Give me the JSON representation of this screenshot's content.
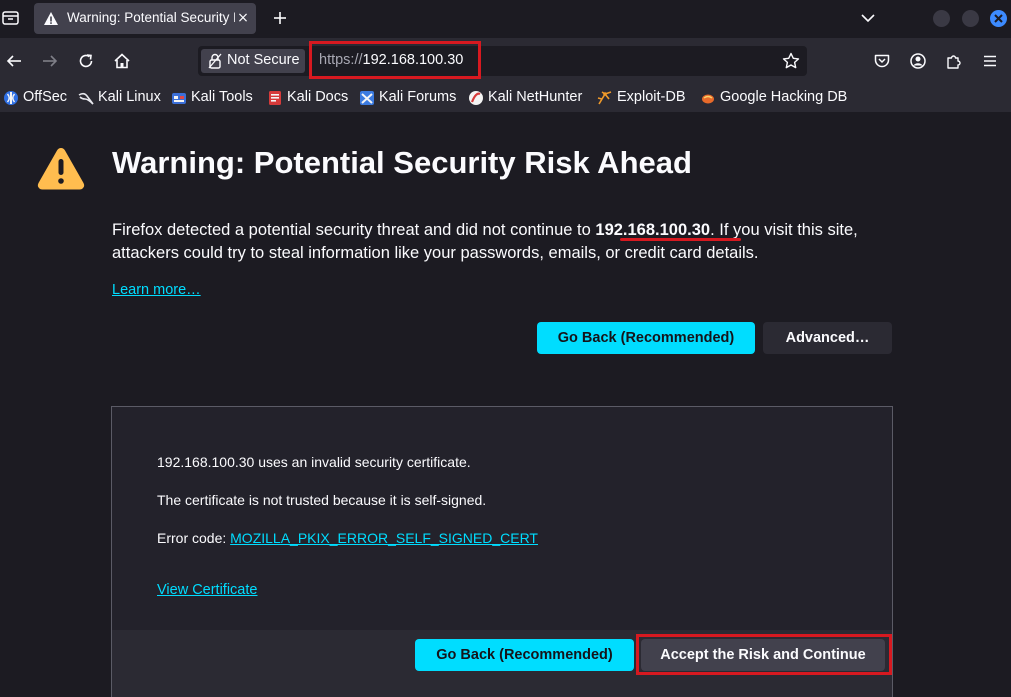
{
  "tab": {
    "title": "Warning: Potential Security Risk Ahead",
    "close": "×"
  },
  "url_bar": {
    "identity_label": "Not Secure",
    "scheme": "https://",
    "host": "192.168.100.30"
  },
  "bookmarks": [
    {
      "label": "OffSec",
      "icon": "offsec-icon"
    },
    {
      "label": "Kali Linux",
      "icon": "kali-dragon-icon"
    },
    {
      "label": "Kali Tools",
      "icon": "kali-tools-icon"
    },
    {
      "label": "Kali Docs",
      "icon": "kali-docs-icon"
    },
    {
      "label": "Kali Forums",
      "icon": "kali-forums-icon"
    },
    {
      "label": "Kali NetHunter",
      "icon": "nethunter-icon"
    },
    {
      "label": "Exploit-DB",
      "icon": "exploit-db-icon"
    },
    {
      "label": "Google Hacking DB",
      "icon": "ghdb-icon"
    }
  ],
  "page": {
    "title": "Warning: Potential Security Risk Ahead",
    "intro_before": "Firefox detected a potential security threat and did not continue to ",
    "intro_host": "192.168.100.30",
    "intro_after": ". If you visit this site, attackers could try to steal information like your passwords, emails, or credit card details.",
    "learn_more": "Learn more…",
    "go_back": "Go Back (Recommended)",
    "advanced": "Advanced…"
  },
  "advanced_panel": {
    "line1": "192.168.100.30 uses an invalid security certificate.",
    "line2": "The certificate is not trusted because it is self-signed.",
    "error_code_label": "Error code: ",
    "error_code": "MOZILLA_PKIX_ERROR_SELF_SIGNED_CERT",
    "view_certificate": "View Certificate",
    "go_back": "Go Back (Recommended)",
    "accept": "Accept the Risk and Continue"
  },
  "colors": {
    "accent": "#00ddff",
    "annotation": "#d71920",
    "warning": "#ffbd4f",
    "background": "#1c1b22"
  }
}
